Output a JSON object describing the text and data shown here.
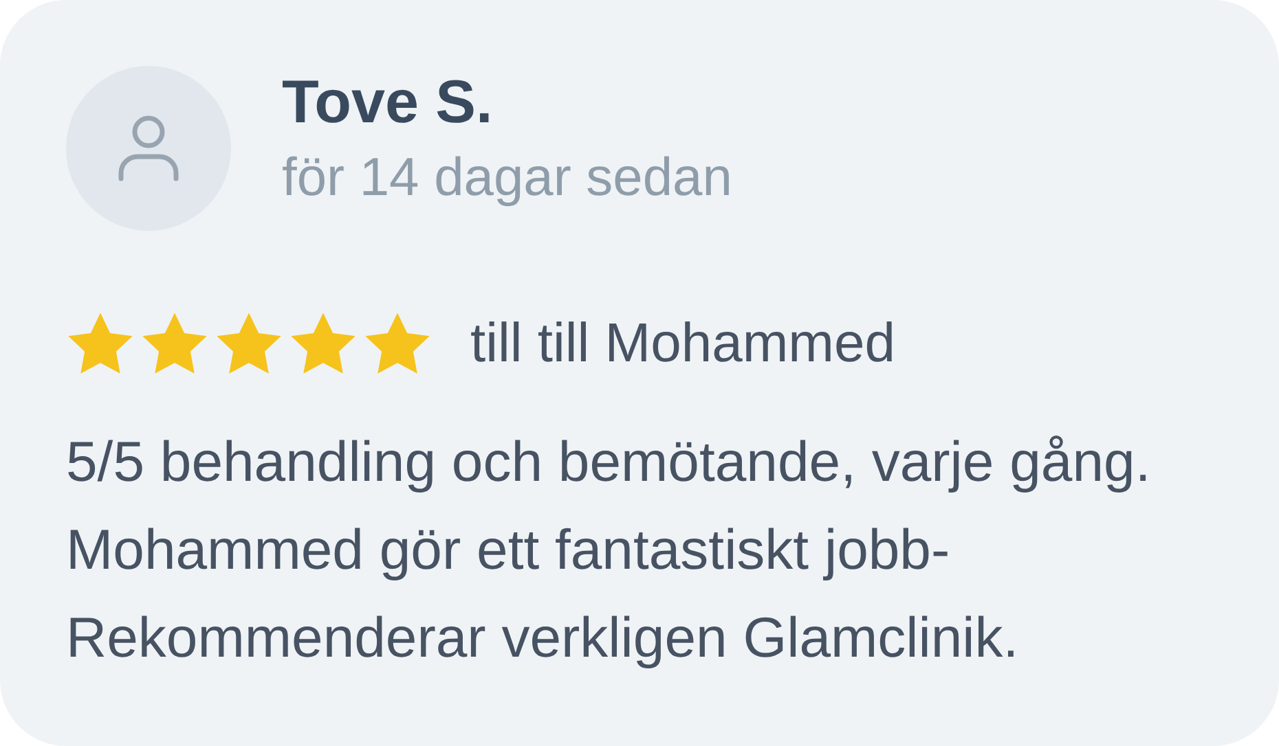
{
  "review": {
    "author": "Tove S.",
    "time": "för 14 dagar sedan",
    "stars": 5,
    "recipient": "till till Mohammed",
    "text": "5/5 behandling och bemötande, varje gång. Mohammed gör ett fantastiskt jobb- Rekommenderar verkligen Glamclinik."
  }
}
